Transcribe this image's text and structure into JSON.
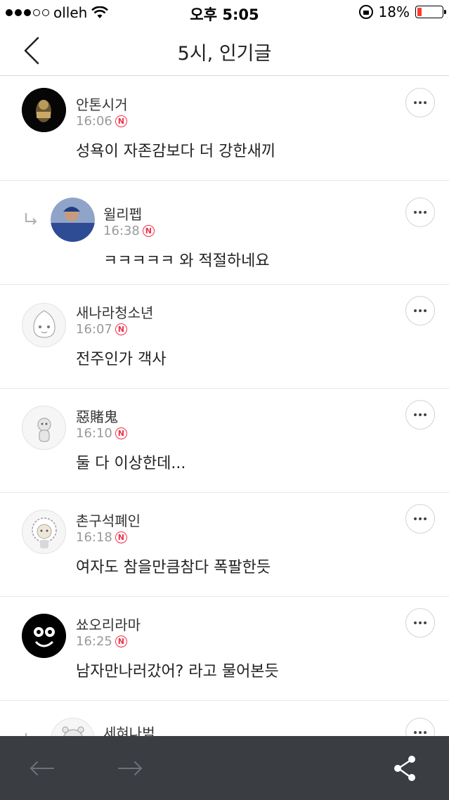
{
  "status_bar": {
    "carrier": "olleh",
    "time": "오후 5:05",
    "battery_percent": "18%",
    "battery_level": 0.18
  },
  "header": {
    "title": "5시, 인기글",
    "back_icon": "chevron-left-icon"
  },
  "comments": [
    {
      "name": "안톤시거",
      "time": "16:06",
      "text": "성욕이 자존감보다 더 강한새끼",
      "badge": "N",
      "reply": false
    },
    {
      "name": "윌리펩",
      "time": "16:38",
      "text": "ㅋㅋㅋㅋㅋ 와 적절하네요",
      "badge": "N",
      "reply": true
    },
    {
      "name": "새나라청소년",
      "time": "16:07",
      "text": "전주인가 객사",
      "badge": "N",
      "reply": false
    },
    {
      "name": "惡賭鬼",
      "time": "16:10",
      "text": "둘 다 이상한데...",
      "badge": "N",
      "reply": false
    },
    {
      "name": "촌구석폐인",
      "time": "16:18",
      "text": "여자도 참을만큼참다 폭팔한듯",
      "badge": "N",
      "reply": false
    },
    {
      "name": "쑈오리라마",
      "time": "16:25",
      "text": "남자만나러갔어? 라고 물어본듯",
      "badge": "N",
      "reply": false
    },
    {
      "name": "세혀나범",
      "time": "",
      "text": "",
      "badge": "",
      "reply": true
    }
  ],
  "bottom_bar": {
    "back_icon": "arrow-left-icon",
    "forward_icon": "arrow-right-icon",
    "share_icon": "share-icon"
  },
  "colors": {
    "badge": "#f0304a",
    "bottom_bar": "#3a3d42",
    "battery_low": "#ff3b30"
  }
}
